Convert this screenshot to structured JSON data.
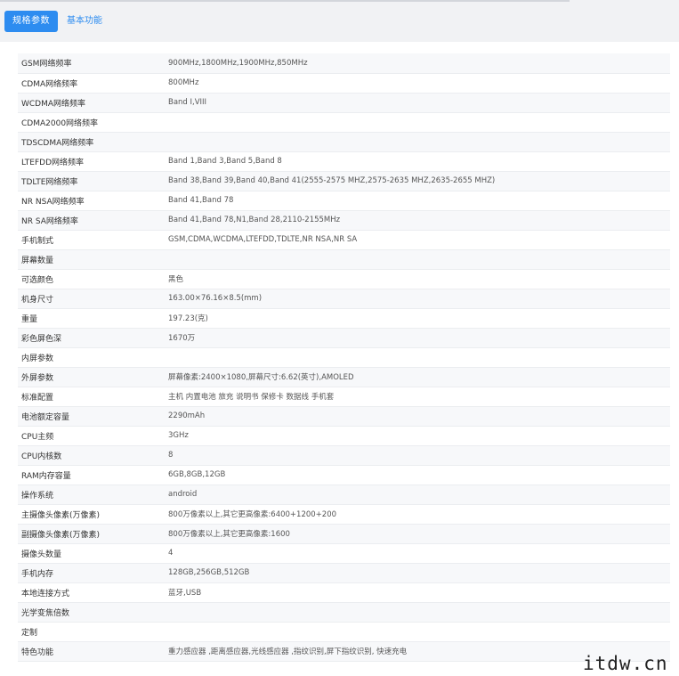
{
  "tabs": {
    "spec_params": "规格参数",
    "basic_functions": "基本功能"
  },
  "specs": [
    {
      "label": "GSM网络频率",
      "value": "900MHz,1800MHz,1900MHz,850MHz"
    },
    {
      "label": "CDMA网络频率",
      "value": "800MHz"
    },
    {
      "label": "WCDMA网络频率",
      "value": "Band Ⅰ,VIII"
    },
    {
      "label": "CDMA2000网络频率",
      "value": ""
    },
    {
      "label": "TDSCDMA网络频率",
      "value": ""
    },
    {
      "label": "LTEFDD网络频率",
      "value": "Band 1,Band 3,Band 5,Band 8"
    },
    {
      "label": "TDLTE网络频率",
      "value": "Band 38,Band 39,Band 40,Band 41(2555-2575 MHZ,2575-2635 MHZ,2635-2655 MHZ)"
    },
    {
      "label": "NR NSA网络频率",
      "value": "Band 41,Band 78"
    },
    {
      "label": "NR SA网络频率",
      "value": "Band 41,Band 78,N1,Band 28,2110-2155MHz"
    },
    {
      "label": "手机制式",
      "value": "GSM,CDMA,WCDMA,LTEFDD,TDLTE,NR NSA,NR SA"
    },
    {
      "label": "屏幕数量",
      "value": ""
    },
    {
      "label": "可选颜色",
      "value": "黑色"
    },
    {
      "label": "机身尺寸",
      "value": "163.00×76.16×8.5(mm)"
    },
    {
      "label": "重量",
      "value": "197.23(克)"
    },
    {
      "label": "彩色屏色深",
      "value": "1670万"
    },
    {
      "label": "内屏参数",
      "value": ""
    },
    {
      "label": "外屏参数",
      "value": "屏幕像素:2400×1080,屏幕尺寸:6.62(英寸),AMOLED"
    },
    {
      "label": "标准配置",
      "value": "主机 内置电池 旅充 说明书 保修卡 数据线 手机套"
    },
    {
      "label": "电池额定容量",
      "value": "2290mAh"
    },
    {
      "label": "CPU主频",
      "value": "3GHz"
    },
    {
      "label": "CPU内核数",
      "value": "8"
    },
    {
      "label": "RAM内存容量",
      "value": "6GB,8GB,12GB"
    },
    {
      "label": "操作系统",
      "value": "android"
    },
    {
      "label": "主摄像头像素(万像素)",
      "value": "800万像素以上,其它更高像素:6400+1200+200"
    },
    {
      "label": "副摄像头像素(万像素)",
      "value": "800万像素以上,其它更高像素:1600"
    },
    {
      "label": "摄像头数量",
      "value": "4"
    },
    {
      "label": "手机内存",
      "value": "128GB,256GB,512GB"
    },
    {
      "label": "本地连接方式",
      "value": "蓝牙,USB"
    },
    {
      "label": "光学变焦倍数",
      "value": ""
    },
    {
      "label": "定制",
      "value": ""
    },
    {
      "label": "特色功能",
      "value": "重力感应器 ,距离感应器,光线感应器 ,指纹识别,屏下指纹识别, 快速充电"
    }
  ],
  "watermark": "itdw.cn"
}
